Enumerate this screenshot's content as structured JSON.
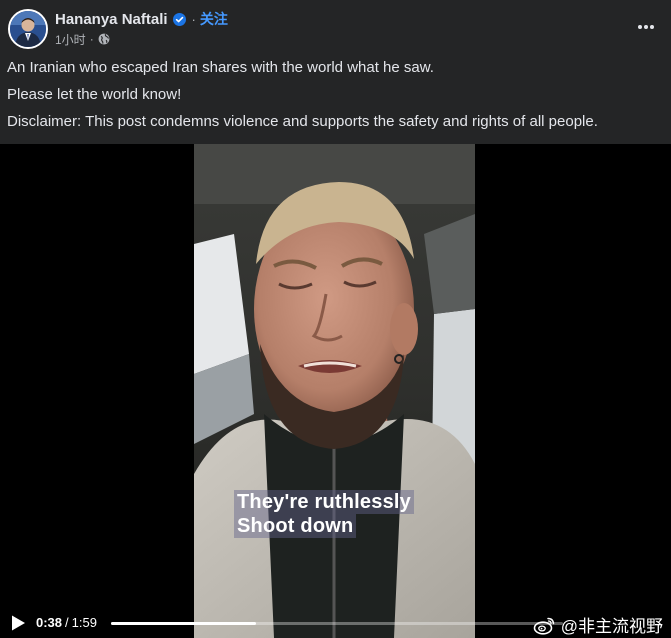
{
  "post": {
    "author_name": "Hananya Naftali",
    "follow_label": "关注",
    "timestamp": "1小时",
    "privacy_icon": "globe-icon",
    "verified_icon": "verified-badge-icon",
    "more_icon": "more-horizontal-icon",
    "paragraphs": [
      "An Iranian who escaped Iran shares with the world what he saw.",
      "Please let the world know!",
      "Disclaimer: This post condemns violence and supports the safety and rights of all people."
    ]
  },
  "video": {
    "caption_lines": [
      "They're ruthlessly",
      "Shoot down"
    ],
    "current_time": "0:38",
    "duration": "1:59",
    "progress_fraction": 0.32,
    "play_icon": "play-icon"
  },
  "watermark": {
    "text": "@非主流视野",
    "icon": "weibo-icon"
  },
  "colors": {
    "background": "#242526",
    "link_blue": "#4599ff",
    "verified_blue": "#1b74e4",
    "text_primary": "#e4e6eb",
    "text_secondary": "#b0b3b8"
  }
}
